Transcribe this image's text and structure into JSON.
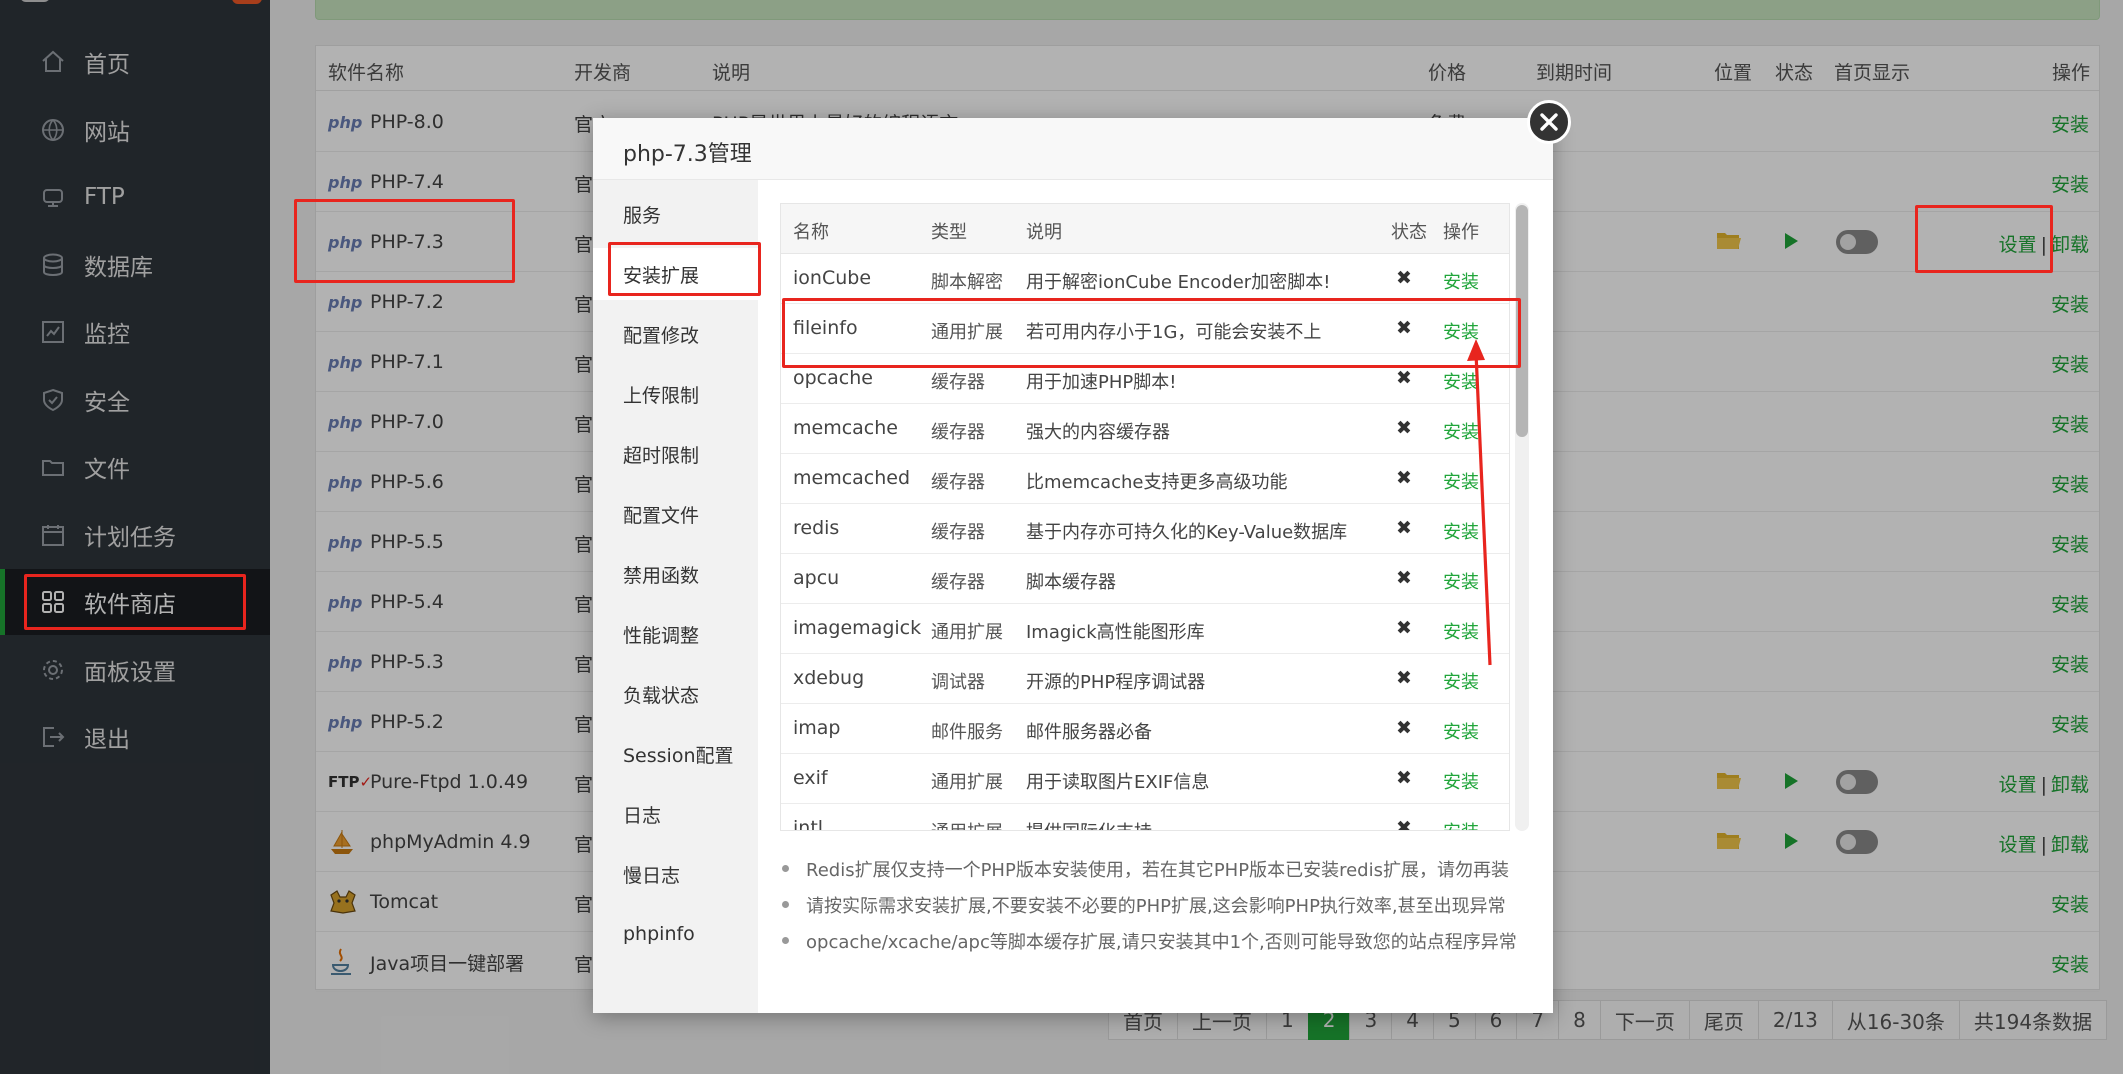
{
  "sidebar": {
    "items": [
      {
        "label": "首页",
        "icon": "home-icon"
      },
      {
        "label": "网站",
        "icon": "globe-icon"
      },
      {
        "label": "FTP",
        "icon": "ftp-icon"
      },
      {
        "label": "数据库",
        "icon": "database-icon"
      },
      {
        "label": "监控",
        "icon": "monitor-icon"
      },
      {
        "label": "安全",
        "icon": "shield-icon"
      },
      {
        "label": "文件",
        "icon": "folder-icon"
      },
      {
        "label": "计划任务",
        "icon": "calendar-icon"
      },
      {
        "label": "软件商店",
        "icon": "apps-grid-icon"
      },
      {
        "label": "面板设置",
        "icon": "gear-icon"
      },
      {
        "label": "退出",
        "icon": "logout-icon"
      }
    ],
    "active_index": 8,
    "accent": "#20a53a"
  },
  "table": {
    "headers": {
      "name": "软件名称",
      "developer": "开发商",
      "desc": "说明",
      "price": "价格",
      "expire": "到期时间",
      "location": "位置",
      "status": "状态",
      "homepage": "首页显示",
      "ops": "操作"
    },
    "rows": [
      {
        "name": "PHP-8.0",
        "icon": "php-logo-icon",
        "developer": "官方",
        "action": "安装"
      },
      {
        "name": "PHP-7.4",
        "icon": "php-logo-icon",
        "developer": "官方",
        "action": "安装"
      },
      {
        "name": "PHP-7.3",
        "icon": "php-logo-icon",
        "developer": "官",
        "action_settings": "设置",
        "action_sep": "|",
        "action_uninstall": "卸载"
      },
      {
        "name": "PHP-7.2",
        "icon": "php-logo-icon",
        "developer": "官",
        "action": "安装"
      },
      {
        "name": "PHP-7.1",
        "icon": "php-logo-icon",
        "developer": "官",
        "action": "安装"
      },
      {
        "name": "PHP-7.0",
        "icon": "php-logo-icon",
        "developer": "官",
        "action": "安装"
      },
      {
        "name": "PHP-5.6",
        "icon": "php-logo-icon",
        "developer": "官",
        "action": "安装"
      },
      {
        "name": "PHP-5.5",
        "icon": "php-logo-icon",
        "developer": "官",
        "action": "安装"
      },
      {
        "name": "PHP-5.4",
        "icon": "php-logo-icon",
        "developer": "官",
        "action": "安装"
      },
      {
        "name": "PHP-5.3",
        "icon": "php-logo-icon",
        "developer": "官",
        "action": "安装"
      },
      {
        "name": "PHP-5.2",
        "icon": "php-logo-icon",
        "developer": "官",
        "action": "安装"
      },
      {
        "name": "Pure-Ftpd 1.0.49",
        "icon": "ftp-logo-icon",
        "developer": "官",
        "action_settings": "设置",
        "action_sep": "|",
        "action_uninstall": "卸载"
      },
      {
        "name": "phpMyAdmin 4.9",
        "icon": "ship-logo-icon",
        "developer": "官",
        "action_settings": "设置",
        "action_sep": "|",
        "action_uninstall": "卸载"
      },
      {
        "name": "Tomcat",
        "icon": "tomcat-logo-icon",
        "developer": "官",
        "action": "安装"
      },
      {
        "name": "Java项目一键部署",
        "icon": "java-logo-icon",
        "developer": "官",
        "action": "安装"
      }
    ],
    "row0_desc": "PHP是世界上最好的编程语言",
    "row0_price": "免费"
  },
  "pager": {
    "items": [
      "首页",
      "上一页",
      "1",
      "2",
      "3",
      "4",
      "5",
      "6",
      "7",
      "8",
      "下一页",
      "尾页",
      "2/13",
      "从16-30条",
      "共194条数据"
    ],
    "current": "2"
  },
  "modal": {
    "title": "php-7.3管理",
    "nav": [
      "服务",
      "安装扩展",
      "配置修改",
      "上传限制",
      "超时限制",
      "配置文件",
      "禁用函数",
      "性能调整",
      "负载状态",
      "Session配置",
      "日志",
      "慢日志",
      "phpinfo"
    ],
    "nav_active": "安装扩展",
    "ext_headers": {
      "name": "名称",
      "type": "类型",
      "desc": "说明",
      "status": "状态",
      "op": "操作"
    },
    "extensions": [
      {
        "name": "ionCube",
        "type": "脚本解密",
        "desc": "用于解密ionCube Encoder加密脚本!",
        "status": "✖",
        "op": "安装"
      },
      {
        "name": "fileinfo",
        "type": "通用扩展",
        "desc": "若可用内存小于1G，可能会安装不上",
        "status": "✖",
        "op": "安装"
      },
      {
        "name": "opcache",
        "type": "缓存器",
        "desc": "用于加速PHP脚本!",
        "status": "✖",
        "op": "安装"
      },
      {
        "name": "memcache",
        "type": "缓存器",
        "desc": "强大的内容缓存器",
        "status": "✖",
        "op": "安装"
      },
      {
        "name": "memcached",
        "type": "缓存器",
        "desc": "比memcache支持更多高级功能",
        "status": "✖",
        "op": "安装"
      },
      {
        "name": "redis",
        "type": "缓存器",
        "desc": "基于内存亦可持久化的Key-Value数据库",
        "status": "✖",
        "op": "安装"
      },
      {
        "name": "apcu",
        "type": "缓存器",
        "desc": "脚本缓存器",
        "status": "✖",
        "op": "安装"
      },
      {
        "name": "imagemagick",
        "type": "通用扩展",
        "desc": "Imagick高性能图形库",
        "status": "✖",
        "op": "安装"
      },
      {
        "name": "xdebug",
        "type": "调试器",
        "desc": "开源的PHP程序调试器",
        "status": "✖",
        "op": "安装"
      },
      {
        "name": "imap",
        "type": "邮件服务",
        "desc": "邮件服务器必备",
        "status": "✖",
        "op": "安装"
      },
      {
        "name": "exif",
        "type": "通用扩展",
        "desc": "用于读取图片EXIF信息",
        "status": "✖",
        "op": "安装"
      },
      {
        "name": "intl",
        "type": "通用扩展",
        "desc": "提供国际化支持",
        "status": "✖",
        "op": "安装"
      }
    ],
    "notes": [
      "Redis扩展仅支持一个PHP版本安装使用，若在其它PHP版本已安装redis扩展，请勿再装",
      "请按实际需求安装扩展,不要安装不必要的PHP扩展,这会影响PHP执行效率,甚至出现异常",
      "opcache/xcache/apc等脚本缓存扩展,请只安装其中1个,否则可能导致您的站点程序异常"
    ]
  },
  "colors": {
    "accent": "#20a53a",
    "annotation": "#e8251e",
    "sidebar_bg": "#2f353b"
  }
}
